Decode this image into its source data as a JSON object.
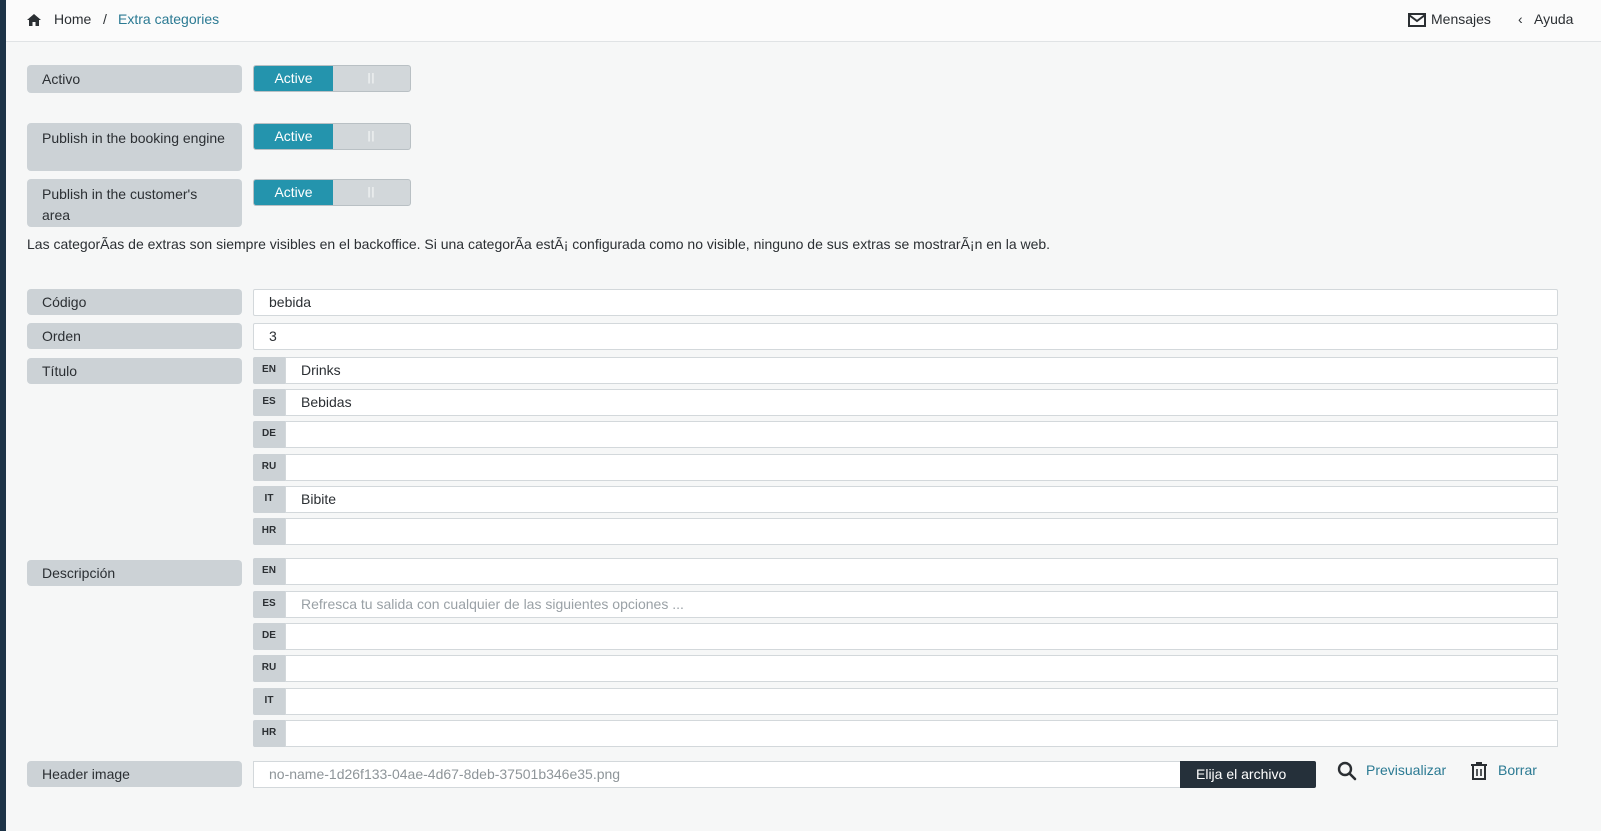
{
  "breadcrumb": {
    "home": "Home",
    "separator": "/",
    "current": "Extra categories"
  },
  "header": {
    "messages": "Mensajes",
    "help_chevron": "‹",
    "help": "Ayuda"
  },
  "toggles": [
    {
      "label": "Activo",
      "state": "Active",
      "handle": "||"
    },
    {
      "label": "Publish in the booking engine",
      "state": "Active",
      "handle": "||"
    },
    {
      "label": "Publish in the customer's area",
      "state": "Active",
      "handle": "||"
    }
  ],
  "note": "Las categorÃas de extras son siempre visibles en el backoffice. Si una categorÃa estÃ¡ configurada como no visible, ninguno de sus extras se mostrarÃ¡n en la web.",
  "code": {
    "label": "Código",
    "value": "bebida"
  },
  "order": {
    "label": "Orden",
    "value": "3"
  },
  "title": {
    "label": "Título",
    "langs": [
      {
        "code": "EN",
        "value": "Drinks"
      },
      {
        "code": "ES",
        "value": "Bebidas"
      },
      {
        "code": "DE",
        "value": ""
      },
      {
        "code": "RU",
        "value": ""
      },
      {
        "code": "IT",
        "value": "Bibite"
      },
      {
        "code": "HR",
        "value": ""
      }
    ]
  },
  "description": {
    "label": "Descripción",
    "langs": [
      {
        "code": "EN",
        "value": ""
      },
      {
        "code": "ES",
        "value": "Refresca tu salida con cualquier de las siguientes opciones ..."
      },
      {
        "code": "DE",
        "value": ""
      },
      {
        "code": "RU",
        "value": ""
      },
      {
        "code": "IT",
        "value": ""
      },
      {
        "code": "HR",
        "value": ""
      }
    ]
  },
  "header_image": {
    "label": "Header image",
    "filename": "no-name-1d26f133-04ae-4d67-8deb-37501b346e35.png",
    "choose": "Elija el archivo",
    "preview": "Previsualizar",
    "delete": "Borrar"
  },
  "colors": {
    "accent": "#2494ad",
    "link": "#2b7a93",
    "sidebar": "#1d3347",
    "label_bg": "#ccd2d6"
  }
}
